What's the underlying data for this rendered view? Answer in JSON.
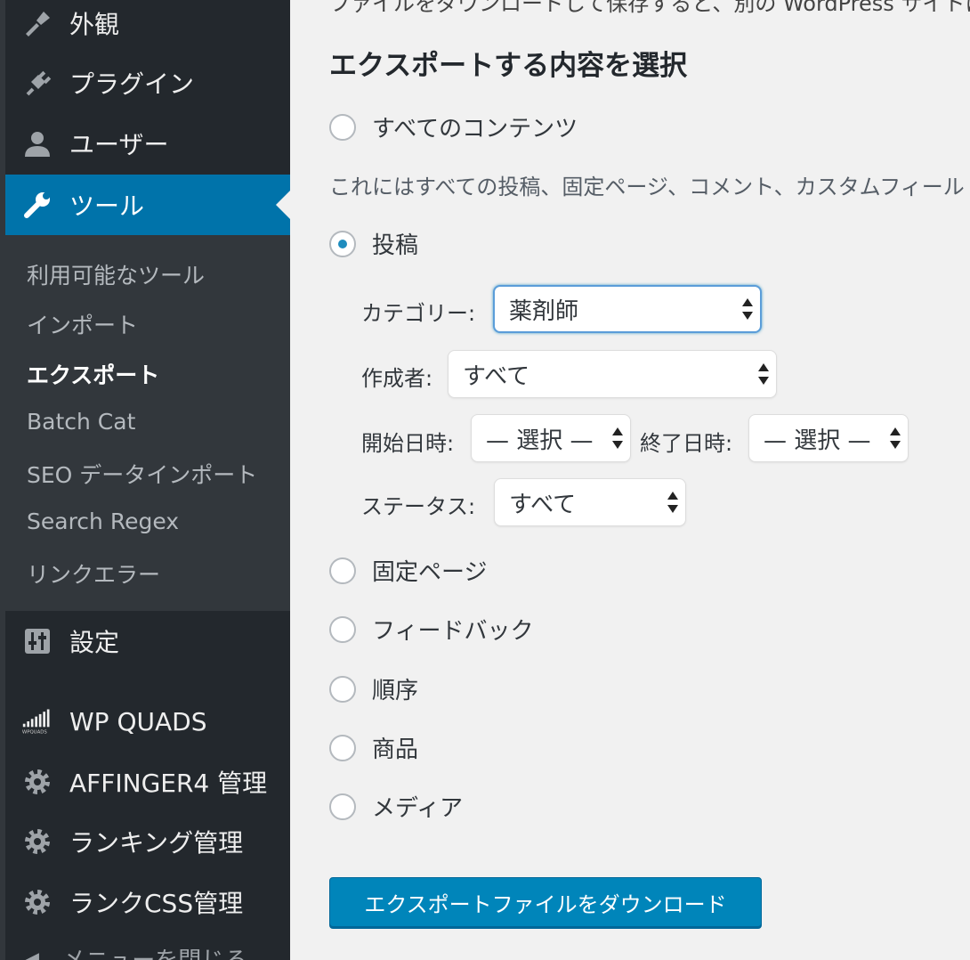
{
  "sidebar": {
    "menu": [
      {
        "label": "外観",
        "icon": "paintbrush-icon"
      },
      {
        "label": "プラグイン",
        "icon": "plugin-icon"
      },
      {
        "label": "ユーザー",
        "icon": "user-icon"
      },
      {
        "label": "ツール",
        "icon": "wrench-icon",
        "active": true
      }
    ],
    "submenu": [
      {
        "label": "利用可能なツール"
      },
      {
        "label": "インポート"
      },
      {
        "label": "エクスポート",
        "current": true
      },
      {
        "label": "Batch Cat"
      },
      {
        "label": "SEO データインポート"
      },
      {
        "label": "Search Regex"
      },
      {
        "label": "リンクエラー"
      }
    ],
    "menu_lower": [
      {
        "label": "設定",
        "icon": "settings-sliders-icon"
      },
      {
        "label": "WP QUADS",
        "icon": "wpquads-icon",
        "icon_text": "WPQUADS"
      },
      {
        "label": "AFFINGER4 管理",
        "icon": "gear-icon"
      },
      {
        "label": "ランキング管理",
        "icon": "gear-icon"
      },
      {
        "label": "ランクCSS管理",
        "icon": "gear-icon"
      }
    ],
    "collapse_label": "メニューを閉じる"
  },
  "main": {
    "intro_text": "ファイルをダウンロードして保存すると、別の WordPress サイトにインポートできます。",
    "heading": "エクスポートする内容を選択",
    "all_content": {
      "label": "すべてのコンテンツ",
      "checked": false
    },
    "all_description": "これにはすべての投稿、固定ページ、コメント、カスタムフィールド",
    "posts": {
      "label": "投稿",
      "checked": true,
      "category_label": "カテゴリー:",
      "category_value": "薬剤師",
      "author_label": "作成者:",
      "author_value": "すべて",
      "start_label": "開始日時:",
      "start_value": "— 選択 —",
      "end_label": "終了日時:",
      "end_value": "— 選択 —",
      "status_label": "ステータス:",
      "status_value": "すべて"
    },
    "other_options": [
      {
        "label": "固定ページ",
        "checked": false
      },
      {
        "label": "フィードバック",
        "checked": false
      },
      {
        "label": "順序",
        "checked": false
      },
      {
        "label": "商品",
        "checked": false
      },
      {
        "label": "メディア",
        "checked": false
      }
    ],
    "download_button": "エクスポートファイルをダウンロード"
  },
  "colors": {
    "sidebar_bg": "#23282d",
    "submenu_bg": "#32373c",
    "active_bg": "#0073aa",
    "button_bg": "#0085ba",
    "content_bg": "#f1f1f1"
  }
}
